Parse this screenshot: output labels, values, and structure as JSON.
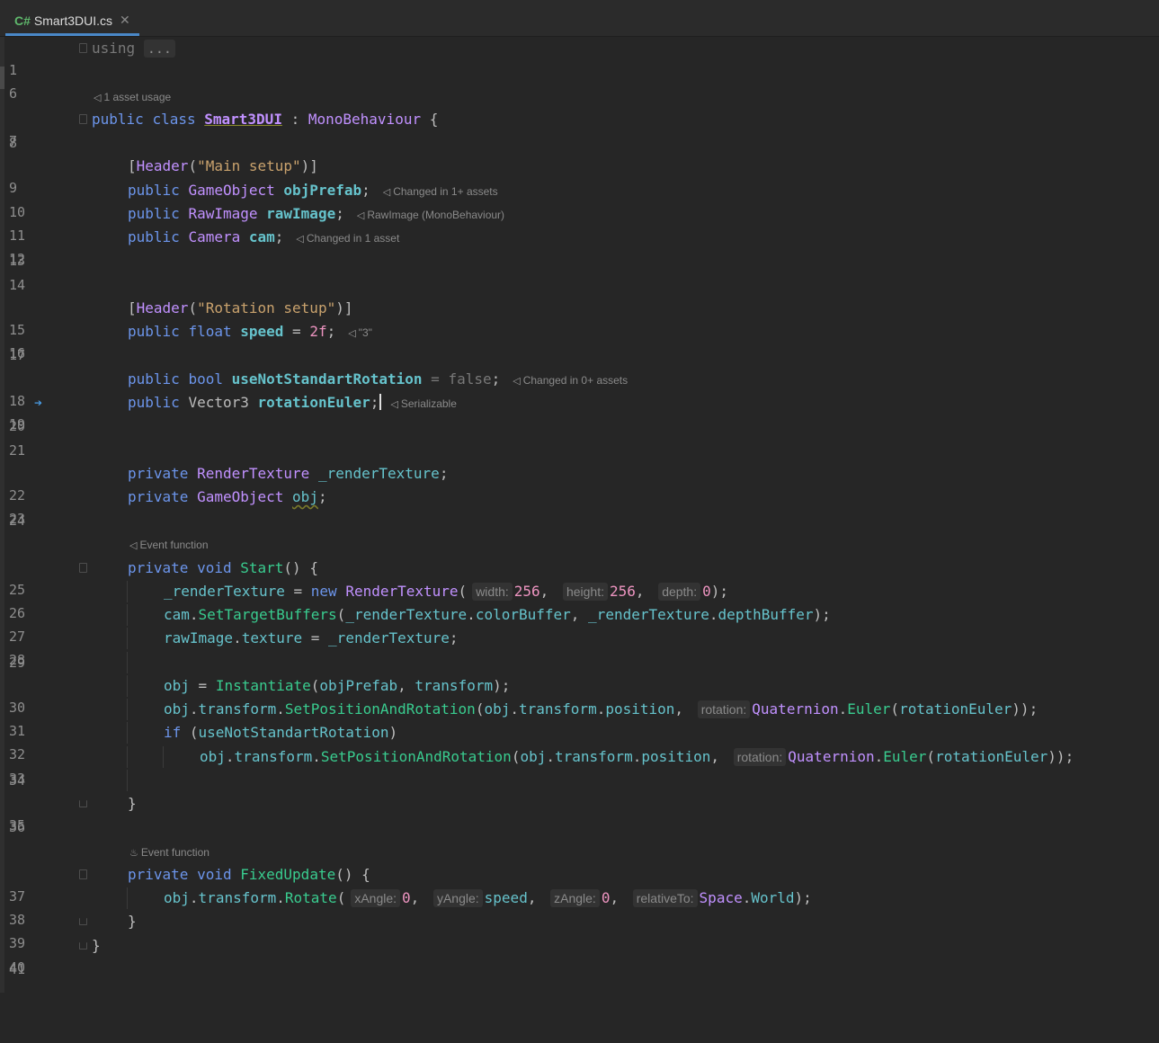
{
  "tab": {
    "lang_badge": "C#",
    "filename": "Smart3DUI.cs",
    "close_icon": "close-icon"
  },
  "hints": {
    "asset_usage": "1 asset usage",
    "event_function_1": "Event function",
    "event_function_2": "Event function"
  },
  "annotations": {
    "objPrefab": "Changed in 1+ assets",
    "rawImage": "RawImage (MonoBehaviour)",
    "cam": "Changed in 1 asset",
    "speed": "\"3\"",
    "useNot": "Changed in 0+ assets",
    "rotationEuler": "Serializable"
  },
  "inlays": {
    "width": "width:",
    "height": "height:",
    "depth": "depth:",
    "rotation": "rotation:",
    "xAngle": "xAngle:",
    "yAngle": "yAngle:",
    "zAngle": "zAngle:",
    "relativeTo": "relativeTo:"
  },
  "line_numbers": [
    "1",
    "6",
    "7",
    "8",
    "9",
    "10",
    "11",
    "12",
    "13",
    "14",
    "15",
    "16",
    "17",
    "18",
    "19",
    "20",
    "21",
    "22",
    "23",
    "24",
    "25",
    "26",
    "27",
    "28",
    "29",
    "30",
    "31",
    "32",
    "33",
    "34",
    "35",
    "36",
    "37",
    "38",
    "39",
    "40",
    "41"
  ],
  "code": {
    "l1": {
      "kw": "using",
      "collapsed": "..."
    },
    "l7": {
      "a": "public",
      "b": "class",
      "name": "Smart3DUI",
      "colon": " : ",
      "base": "MonoBehaviour",
      "brace": " {"
    },
    "l9": {
      "open": "[",
      "attr": "Header",
      "p1": "(",
      "str": "\"Main setup\"",
      "p2": ")]"
    },
    "l10": {
      "kw": "public",
      "type": "GameObject",
      "field": "objPrefab",
      "end": ";"
    },
    "l11": {
      "kw": "public",
      "type": "RawImage",
      "field": "rawImage",
      "end": ";"
    },
    "l12": {
      "kw": "public",
      "type": "Camera",
      "field": "cam",
      "end": ";"
    },
    "l15": {
      "open": "[",
      "attr": "Header",
      "p1": "(",
      "str": "\"Rotation setup\"",
      "p2": ")]"
    },
    "l16": {
      "kw": "public",
      "kw2": "float",
      "field": "speed",
      "eq": " = ",
      "num": "2f",
      "end": ";"
    },
    "l18": {
      "kw": "public",
      "kw2": "bool",
      "field": "useNotStandartRotation",
      "eq": " = ",
      "val": "false",
      "end": ";"
    },
    "l19": {
      "kw": "public",
      "type": "Vector3",
      "field": "rotationEuler",
      "end": ";"
    },
    "l22": {
      "kw": "private",
      "type": "RenderTexture",
      "field": "_renderTexture",
      "end": ";"
    },
    "l23": {
      "kw": "private",
      "type": "GameObject",
      "field": "obj",
      "end": ";"
    },
    "l25": {
      "kw": "private",
      "kw2": "void",
      "method": "Start",
      "rest": "() {"
    },
    "l26": {
      "f": "_renderTexture",
      "eq": " = ",
      "kw": "new",
      "type": "RenderTexture",
      "p": "(",
      "v1": "256",
      "c1": ",",
      "v2": "256",
      "c2": ",",
      "v3": "0",
      "e": ");"
    },
    "l27": {
      "f": "cam",
      "d1": ".",
      "m": "SetTargetBuffers",
      "p": "(",
      "a1": "_renderTexture",
      "d2": ".",
      "a2": "colorBuffer",
      "c": ", ",
      "a3": "_renderTexture",
      "d3": ".",
      "a4": "depthBuffer",
      "e": ");"
    },
    "l28": {
      "f": "rawImage",
      "d": ".",
      "p": "texture",
      "eq": " = ",
      "v": "_renderTexture",
      "e": ";"
    },
    "l30": {
      "f": "obj",
      "eq": " = ",
      "m": "Instantiate",
      "p": "(",
      "a1": "objPrefab",
      "c": ", ",
      "a2": "transform",
      "e": ");"
    },
    "l31": {
      "f": "obj",
      "d1": ".",
      "t": "transform",
      "d2": ".",
      "m": "SetPositionAndRotation",
      "p": "(",
      "a1": "obj",
      "d3": ".",
      "a2": "transform",
      "d4": ".",
      "a3": "position",
      "c": ",",
      "q": "Quaternion",
      "d5": ".",
      "m2": "Euler",
      "p2": "(",
      "a4": "rotationEuler",
      "e": "));"
    },
    "l32": {
      "kw": "if",
      "p": " (",
      "v": "useNotStandartRotation",
      "e": ")"
    },
    "l33": {
      "f": "obj",
      "d1": ".",
      "t": "transform",
      "d2": ".",
      "m": "SetPositionAndRotation",
      "p": "(",
      "a1": "obj",
      "d3": ".",
      "a2": "transform",
      "d4": ".",
      "a3": "position",
      "c": ",",
      "q": "Quaternion",
      "d5": ".",
      "m2": "Euler",
      "p2": "(",
      "a4": "rotationEuler",
      "e": "));"
    },
    "l35": {
      "b": "}"
    },
    "l37": {
      "kw": "private",
      "kw2": "void",
      "method": "FixedUpdate",
      "rest": "() {"
    },
    "l38": {
      "f": "obj",
      "d1": ".",
      "t": "transform",
      "d2": ".",
      "m": "Rotate",
      "p": "(",
      "v1": "0",
      "c1": ",",
      "v2": "speed",
      "c2": ",",
      "v3": "0",
      "c3": ",",
      "s": "Space",
      "d3": ".",
      "w": "World",
      "e": ");"
    },
    "l39": {
      "b": "}"
    },
    "l40": {
      "b": "}"
    }
  }
}
